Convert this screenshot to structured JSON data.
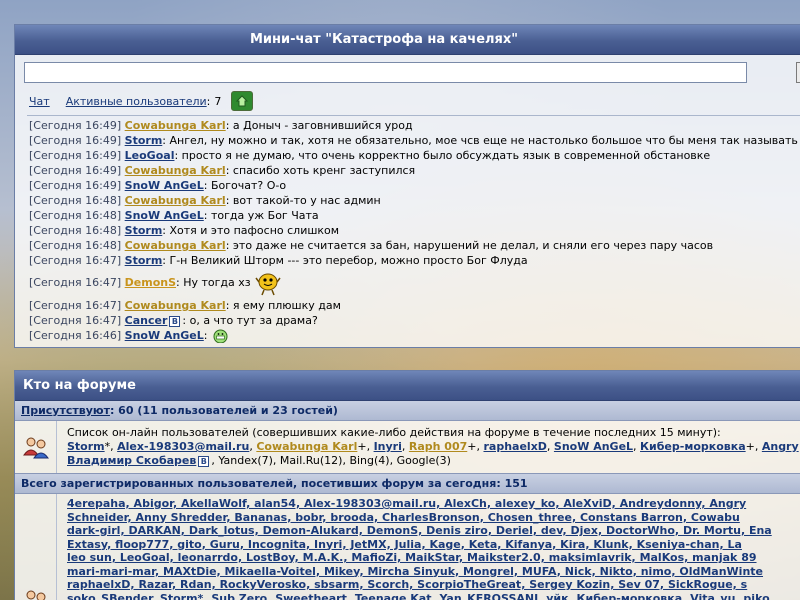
{
  "chat": {
    "title": "Мини-чат \"Катастрофа на качелях\"",
    "input_value": "",
    "nav": {
      "chat_label": "Чат",
      "active_label": "Активные пользователи",
      "active_sep": ":",
      "active_count": "7"
    },
    "messages": [
      {
        "ts": "[Сегодня 16:49]",
        "nick": "Cowabunga Karl",
        "color": "gold",
        "text": ": а Доныч - заговнившийся урод"
      },
      {
        "ts": "[Сегодня 16:49]",
        "nick": "Storm",
        "color": "blue",
        "text": ": Ангел, ну можно и так, хотя не обязательно, мое чсв еще не настолько большое что бы меня так называть"
      },
      {
        "ts": "[Сегодня 16:49]",
        "nick": "LeoGoal",
        "color": "blue",
        "text": ": просто я не думаю, что очень корректно было обсуждать язык в современной обстановке"
      },
      {
        "ts": "[Сегодня 16:49]",
        "nick": "Cowabunga Karl",
        "color": "gold",
        "text": ": спасибо хоть кренг заступился"
      },
      {
        "ts": "[Сегодня 16:49]",
        "nick": "SnoW AnGeL",
        "color": "blue",
        "text": ": Богочат? О-о"
      },
      {
        "ts": "[Сегодня 16:48]",
        "nick": "Cowabunga Karl",
        "color": "gold",
        "text": ": вот такой-то у нас админ"
      },
      {
        "ts": "[Сегодня 16:48]",
        "nick": "SnoW AnGeL",
        "color": "blue",
        "text": ": тогда уж Бог Чата"
      },
      {
        "ts": "[Сегодня 16:48]",
        "nick": "Storm",
        "color": "blue",
        "text": ": Хотя и это пафосно слишком"
      },
      {
        "ts": "[Сегодня 16:48]",
        "nick": "Cowabunga Karl",
        "color": "gold",
        "text": ": это даже не считается за бан, нарушений не делал, и сняли его через пару часов"
      },
      {
        "ts": "[Сегодня 16:47]",
        "nick": "Storm",
        "color": "blue",
        "text": ": Г-н Великий Шторм --- это перебор, можно просто Бог Флуда"
      },
      {
        "ts": "[Сегодня 16:47]",
        "nick": "DemonS",
        "color": "orange",
        "text": ": Ну тогда хз"
      },
      {
        "ts": "[Сегодня 16:47]",
        "nick": "Cowabunga Karl",
        "color": "gold",
        "text": ": я ему плюшку дам"
      },
      {
        "ts": "[Сегодня 16:47]",
        "nick": "Cancer",
        "color": "blue",
        "text": ": о, а что тут за драма?"
      },
      {
        "ts": "[Сегодня 16:46]",
        "nick": "SnoW AnGeL",
        "color": "blue",
        "text": ":"
      }
    ]
  },
  "forum": {
    "title": "Кто на форуме",
    "present_label": "Присутствуют",
    "present_text": ": 60 (11 пользователей и 23 гостей)",
    "online_intro": "Список он-лайн пользователей (совершивших какие-либо действия на форуме в течение последних 15 минут):",
    "online_line2_items": [
      {
        "name": "Storm",
        "suffix": "*, ",
        "color": "blue"
      },
      {
        "name": "Alex-198303@mail.ru",
        "suffix": ", ",
        "color": "blue"
      },
      {
        "name": "Cowabunga Karl",
        "suffix": "+, ",
        "color": "gold"
      },
      {
        "name": "Inyri",
        "suffix": ", ",
        "color": "blue"
      },
      {
        "name": "Raph 007",
        "suffix": "+, ",
        "color": "gold"
      },
      {
        "name": "raphaelxD",
        "suffix": ", ",
        "color": "blue"
      },
      {
        "name": "SnoW AnGeL",
        "suffix": ", ",
        "color": "blue"
      },
      {
        "name": "Кибер-морковка",
        "suffix": "+, ",
        "color": "blue"
      },
      {
        "name": "Angry",
        "suffix": "",
        "color": "blue"
      }
    ],
    "online_line3_name": "Владимир Скобарев",
    "online_line3_rest": ", Yandex(7), Mail.Ru(12), Bing(4), Google(3)",
    "total_text": "Всего зарегистрированных пользователей, посетивших форум за сегодня: 151",
    "users_lines": [
      "4erepaha, Abigor, AkellaWolf, alan54, Alex-198303@mail.ru, AlexCh, alexey_ko, AleXviD, Andreydonny, Angry",
      "Schneider, Anny Shredder, Bananas, bobr, brooda, CharlesBronson, Chosen_three, Constans Barron, Cowabu",
      "dark-girl, DARKAN, Dark_lotus, Demon-Alukard, DemonS, Denis ziro, Deriel, dev, Djex, DoctorWho, Dr. Mortu, Ena",
      "Extasy, floop777, gito, Guru, Incognita, Inyri, JetMX, Julia, Kage, Keta, Kifanya, Kira, Klunk, Kseniya-chan, La",
      "leo sun, LeoGoal, leonarrdo, LostBoy, M.A.K., MafioZi, MaikStar, Maikster2.0, maksimlavrik, MalKos, manjak 89",
      "mari-mari-mar, MAXtDie, Mikaella-Voitel, Mikey, Mircha Sinyuk, Mongrel, MUFA, Nick, Nikto, nimo, OldManWinte",
      "raphaelxD, Razar, Rdan, RockyVerosko, sbsarm, Scorch, ScorpioTheGreat, Sergey Kozin, Sev 07, SickRogue, s",
      "soko_SBender, Storm*, Sub Zero, Sweetheart, Teenage Kat, Yan_KEROSSANI, уйк, Кибер-морковка, Vita_vu, piko"
    ]
  }
}
